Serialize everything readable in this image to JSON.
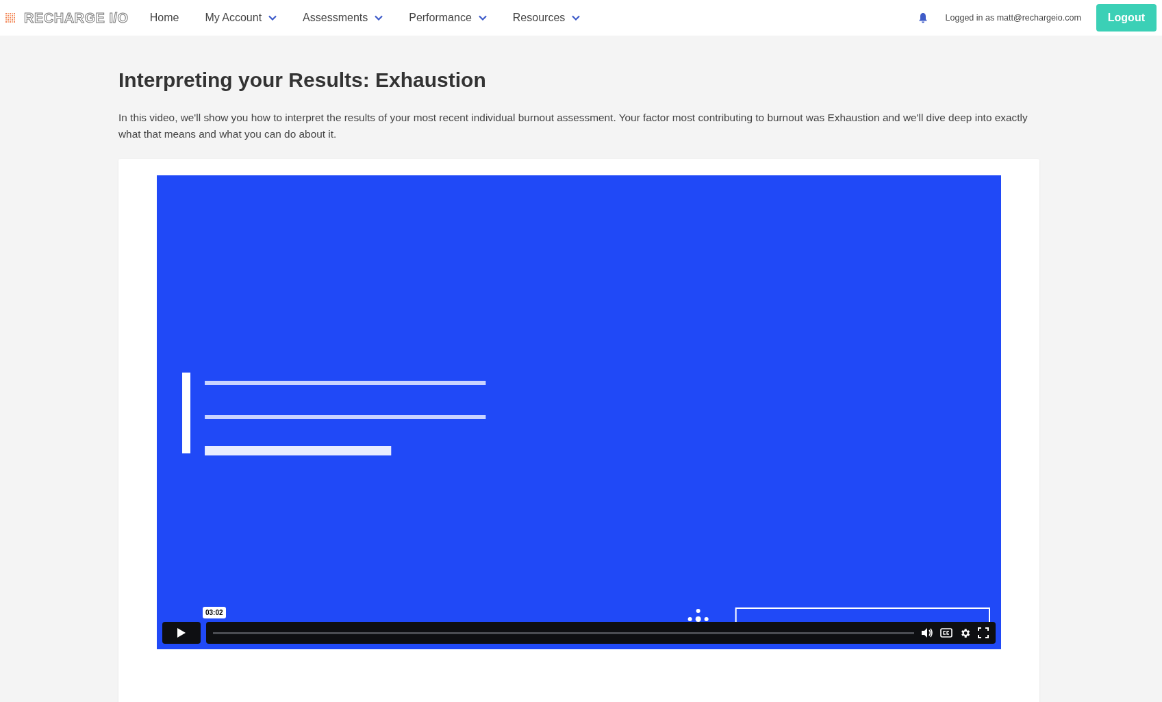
{
  "header": {
    "logo": "RECHARGE I/O",
    "nav": [
      {
        "label": "Home",
        "dropdown": false
      },
      {
        "label": "My Account",
        "dropdown": true
      },
      {
        "label": "Assessments",
        "dropdown": true
      },
      {
        "label": "Performance",
        "dropdown": true
      },
      {
        "label": "Resources",
        "dropdown": true
      }
    ],
    "user_text": "Logged in as matt@rechargeio.com",
    "logout": "Logout"
  },
  "page": {
    "title": "Interpreting your Results: Exhaustion",
    "description": "In this video, we'll show you how to interpret the results of your most recent individual burnout assessment. Your factor most contributing to burnout was Exhaustion and we'll dive deep into exactly what that means and what you can do about it."
  },
  "video": {
    "kind": "picture",
    "time_tooltip": "03:02"
  }
}
